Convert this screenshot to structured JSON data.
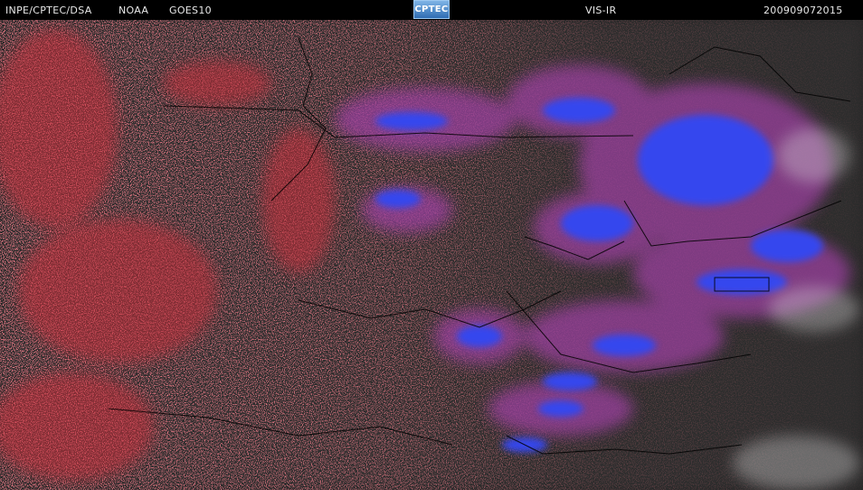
{
  "header": {
    "agency": "INPE/CPTEC/DSA",
    "provider": "NOAA",
    "satellite": "GOES10",
    "logo_text": "CPTEC",
    "channel": "VIS-IR",
    "timestamp": "200909072015"
  },
  "colors": {
    "background": "#2a2a2a",
    "low_cloud": "#d8323e",
    "high_cloud": "#3a4cf0",
    "mid_cloud": "#a04aa8",
    "border_line": "#000000"
  }
}
